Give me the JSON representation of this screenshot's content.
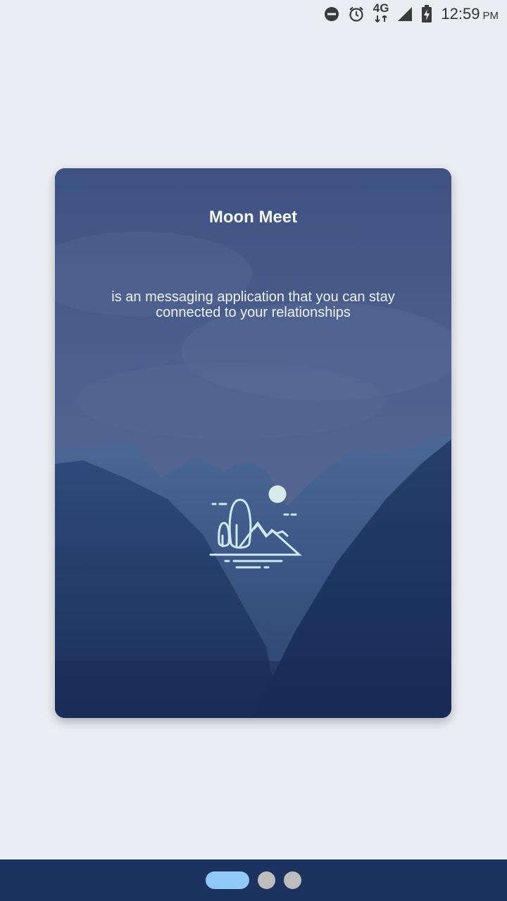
{
  "status_bar": {
    "icons": [
      "do-not-disturb-icon",
      "alarm-icon",
      "network-4g-icon",
      "signal-icon",
      "battery-charging-icon"
    ],
    "network_label": "4G",
    "time": "12:59",
    "ampm": "PM"
  },
  "card": {
    "title": "Moon Meet",
    "description": "is an messaging application that you can stay connected to your relationships",
    "illustration_icon": "landscape-illustration-icon"
  },
  "pager": {
    "pages": 3,
    "active_index": 0
  },
  "colors": {
    "background": "#eaeef3",
    "card": "#3e5584",
    "bottom_bar": "#1c3360",
    "active_dot": "#90c8f8",
    "inactive_dot": "#bdbdbd",
    "illustration": "#cfe8ef"
  }
}
